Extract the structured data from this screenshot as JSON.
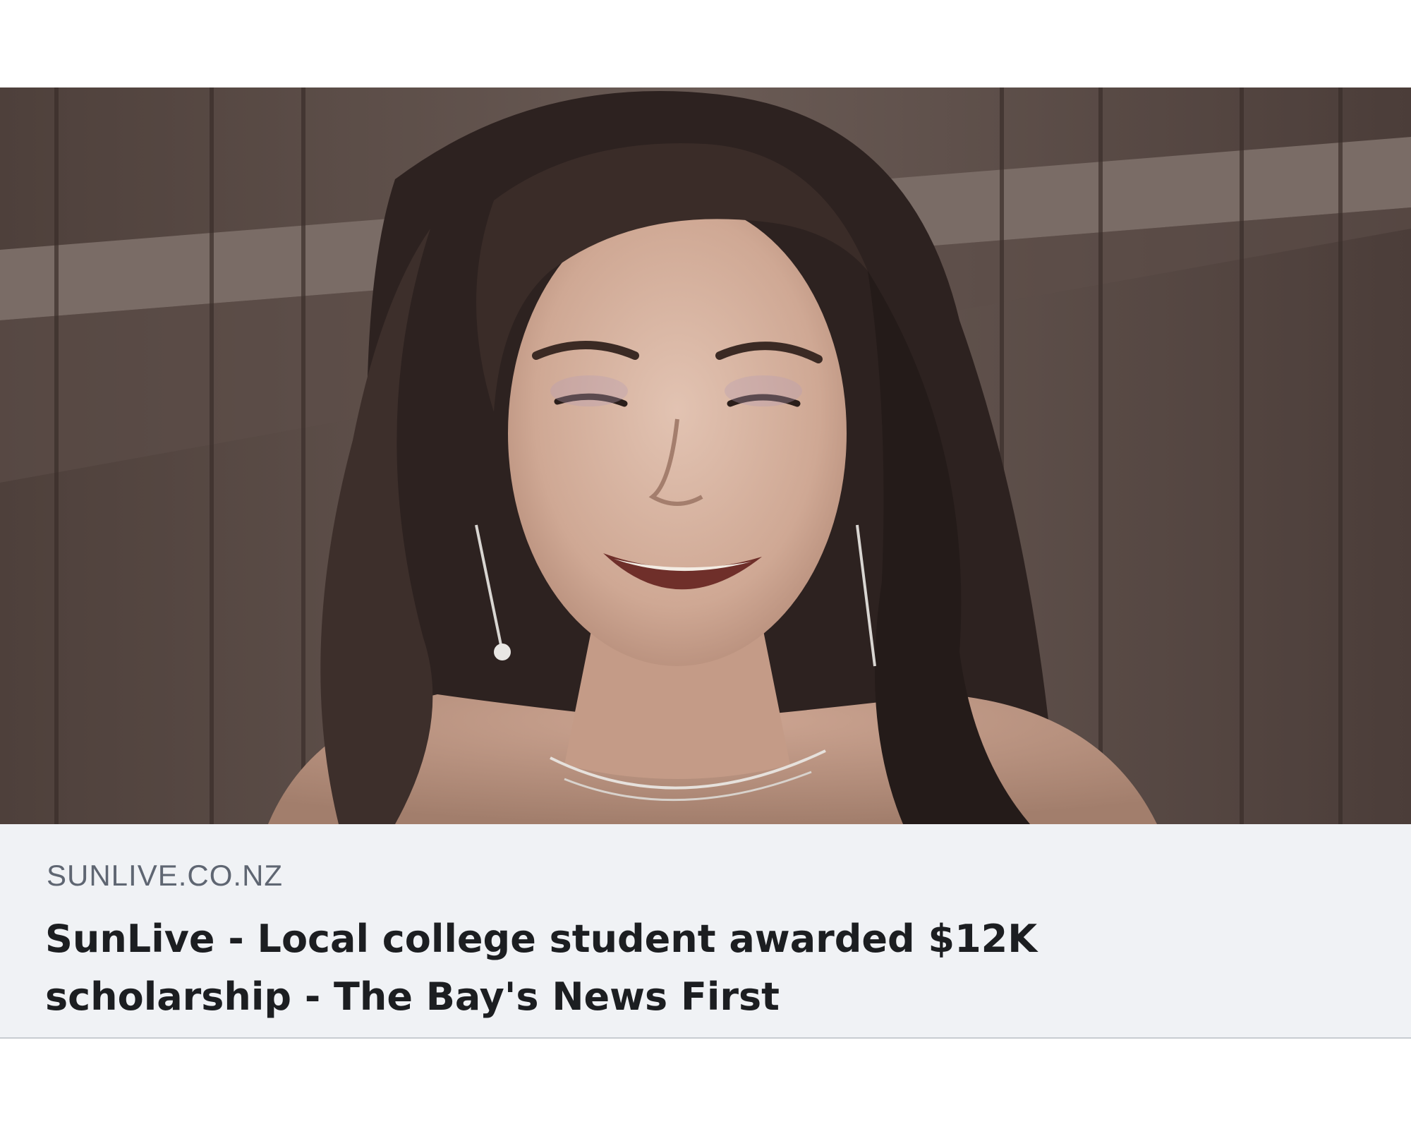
{
  "link_preview": {
    "image": {
      "icon": "article-photo",
      "subject": "smiling young woman with long dark hair in front of a wooden fence"
    },
    "domain": "SUNLIVE.CO.NZ",
    "title": "SunLive - Local college student awarded $12K scholarship - The Bay's News First"
  },
  "colors": {
    "footer_background": "#f0f2f5",
    "domain_text": "#5f6672",
    "title_text": "#1c1e21",
    "border": "#c8ccd1"
  }
}
